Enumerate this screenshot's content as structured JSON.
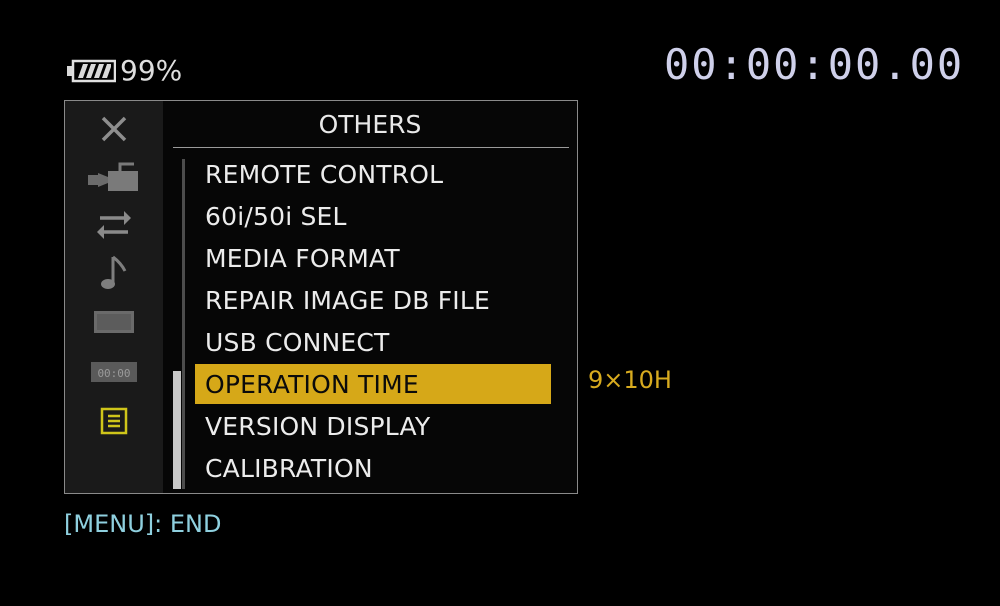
{
  "status": {
    "battery_icon": "battery-icon",
    "battery_percent": "99%",
    "timecode": "00:00:00.00"
  },
  "menu": {
    "title": "OTHERS",
    "icons": [
      {
        "name": "close-icon",
        "glyph": "✕"
      },
      {
        "name": "camera-icon"
      },
      {
        "name": "transfer-arrows-icon",
        "glyph": "⇄"
      },
      {
        "name": "audio-note-icon",
        "glyph": "♪"
      },
      {
        "name": "display-icon"
      },
      {
        "name": "timecode-icon",
        "label": "00:00"
      },
      {
        "name": "others-list-icon"
      }
    ],
    "items": [
      {
        "label": "REMOTE CONTROL"
      },
      {
        "label": "60i/50i SEL"
      },
      {
        "label": "MEDIA FORMAT"
      },
      {
        "label": "REPAIR IMAGE DB FILE"
      },
      {
        "label": "USB CONNECT"
      },
      {
        "label": "OPERATION TIME",
        "value": "9×10H"
      },
      {
        "label": "VERSION DISPLAY"
      },
      {
        "label": "CALIBRATION"
      }
    ]
  },
  "footer": {
    "hint": "[MENU]: END"
  },
  "colors": {
    "selection": "#d6a818",
    "value_text": "#d8ab1f",
    "footer_text": "#8fd0df",
    "timecode_text": "#cfd0ea"
  }
}
